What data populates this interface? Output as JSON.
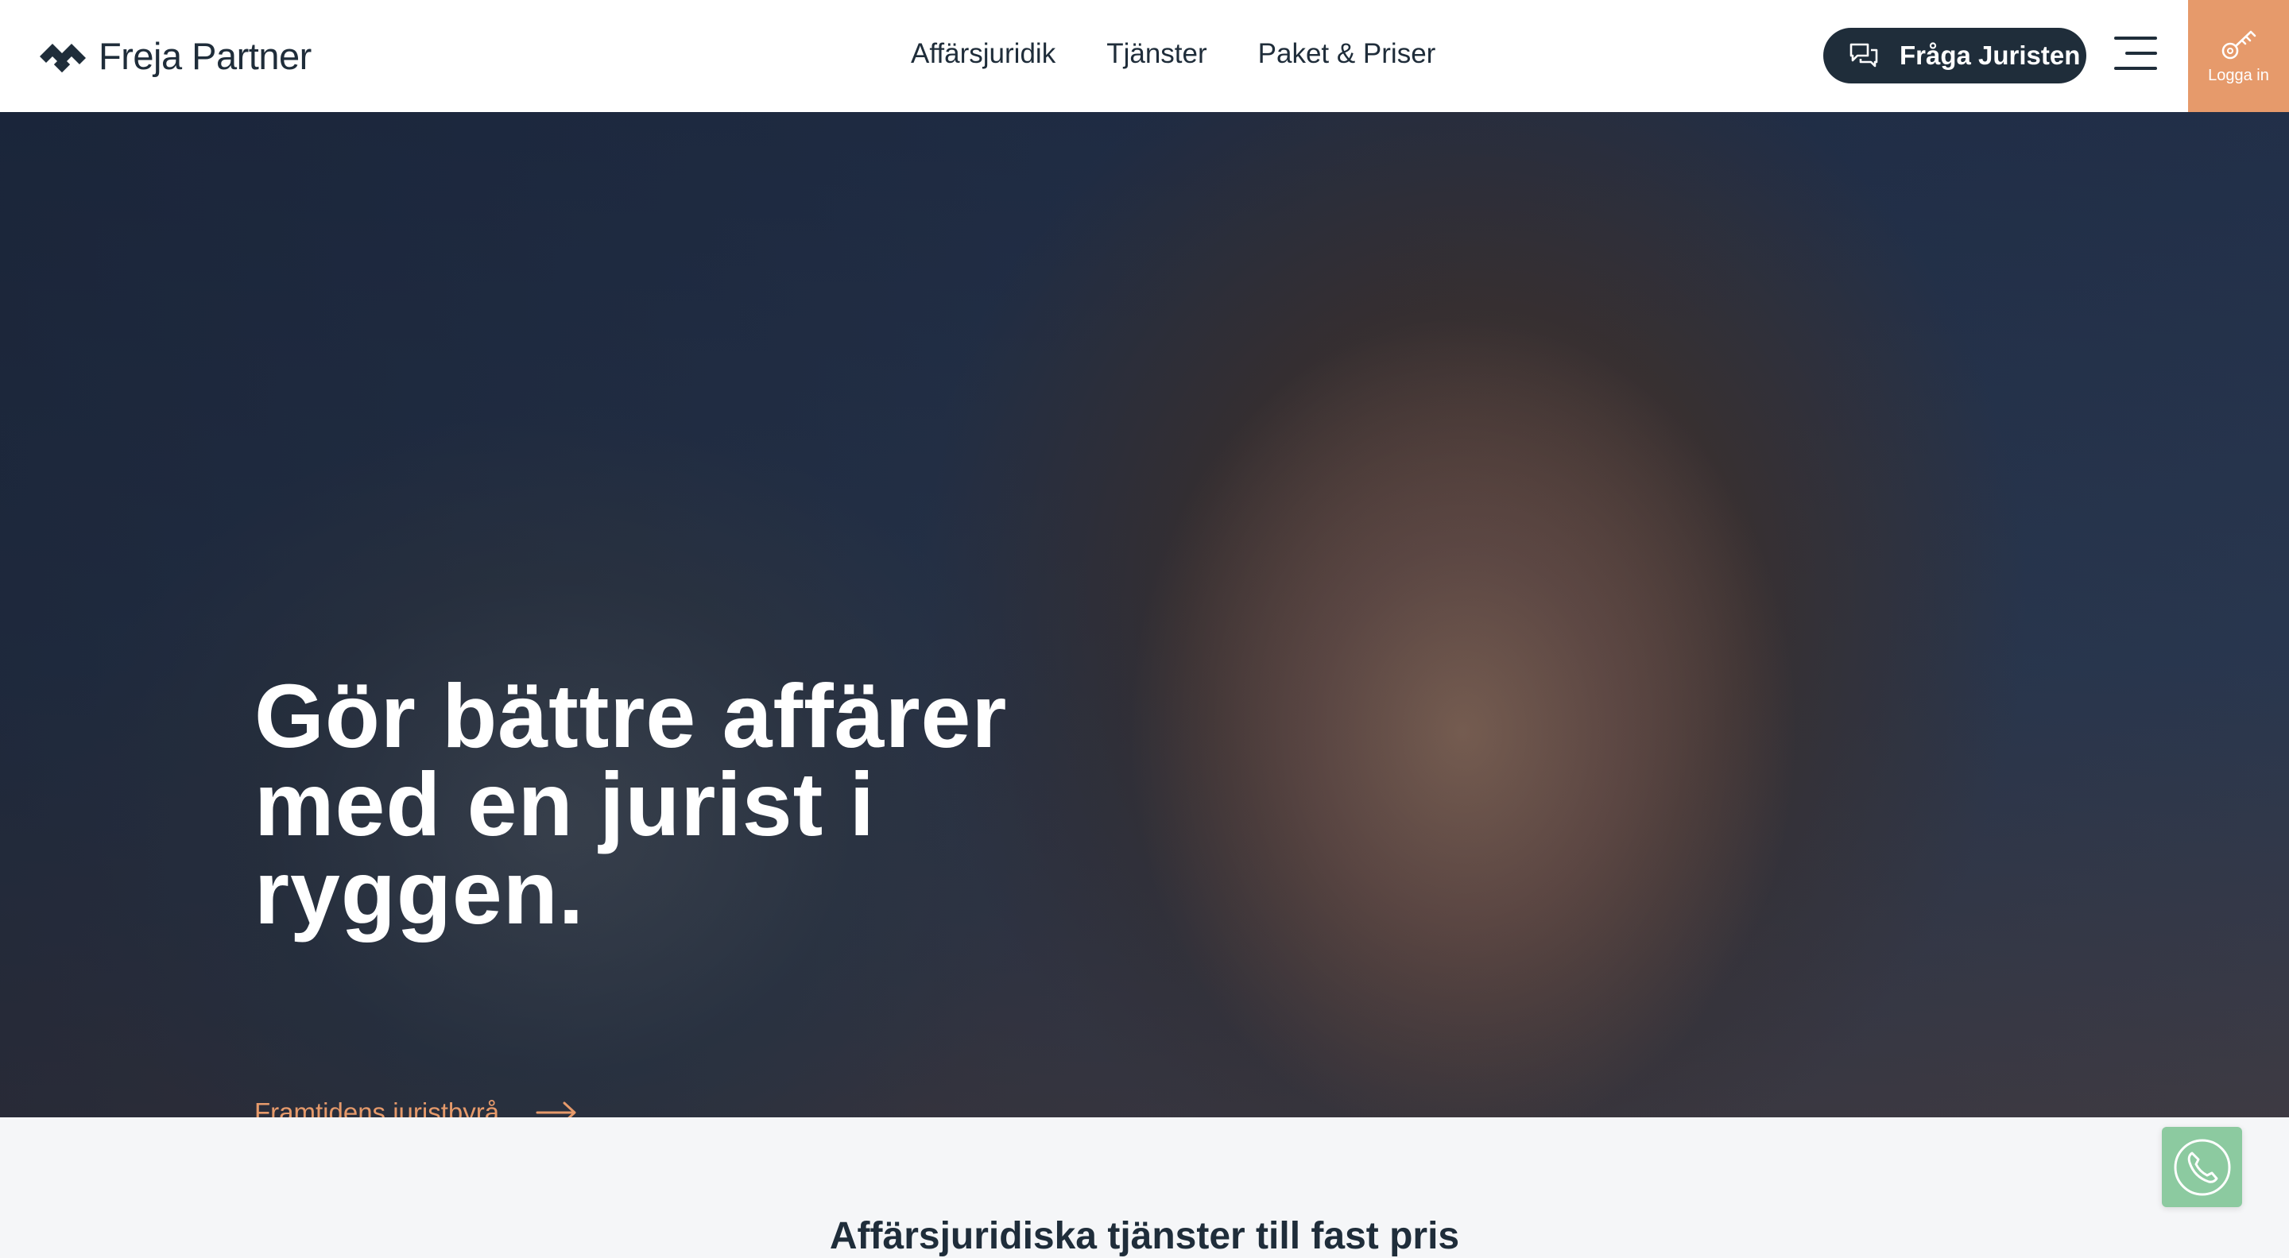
{
  "header": {
    "logo_text": "Freja Partner",
    "nav": [
      {
        "label": "Affärsjuridik"
      },
      {
        "label": "Tjänster"
      },
      {
        "label": "Paket & Priser"
      }
    ],
    "ask_button": "Fråga Juristen",
    "login_label": "Logga in"
  },
  "hero": {
    "title": "Gör bättre affärer med en jurist i ryggen.",
    "link_label": "Framtidens juristbyrå"
  },
  "section": {
    "title": "Affärsjuridiska tjänster till fast pris"
  },
  "icons": {
    "logo": "freja-logo-icon",
    "chat": "chat-bubbles-icon",
    "menu": "hamburger-menu-icon",
    "key": "key-icon",
    "arrow": "arrow-right-icon",
    "phone": "phone-icon"
  },
  "colors": {
    "brand_dark": "#1f2d3a",
    "accent_orange": "#e69a6b",
    "call_green": "#8ccaa0"
  }
}
